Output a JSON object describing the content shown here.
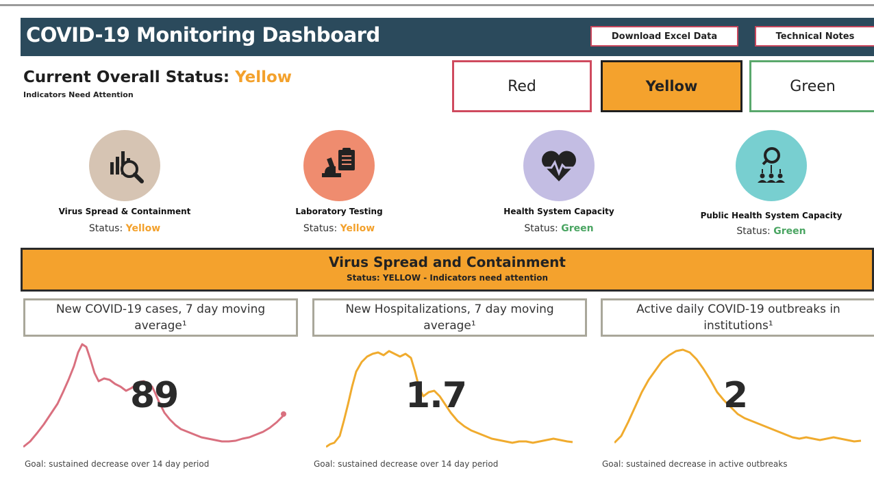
{
  "header": {
    "title": "COVID-19 Monitoring Dashboard",
    "download_label": "Download Excel Data",
    "notes_label": "Technical Notes"
  },
  "overall": {
    "label": "Current Overall Status:",
    "value": "Yellow",
    "subtitle": "Indicators Need Attention"
  },
  "status_boxes": [
    {
      "label": "Red",
      "color": "#cf4a5e"
    },
    {
      "label": "Yellow",
      "color": "#f4a22d"
    },
    {
      "label": "Green",
      "color": "#5aa86c"
    }
  ],
  "indicators": [
    {
      "name": "Virus Spread & Containment",
      "status_label": "Status:",
      "status": "Yellow",
      "icon": "chart-magnifier-icon",
      "circle_color": "#d6c4b3"
    },
    {
      "name": "Laboratory Testing",
      "status_label": "Status:",
      "status": "Yellow",
      "icon": "microscope-clipboard-icon",
      "circle_color": "#ef8c6f"
    },
    {
      "name": "Health System Capacity",
      "status_label": "Status:",
      "status": "Green",
      "icon": "heartbeat-icon",
      "circle_color": "#c3bde3"
    },
    {
      "name": "Public Health System Capacity",
      "status_label": "Status:",
      "status": "Green",
      "icon": "people-search-icon",
      "circle_color": "#78cfd0"
    }
  ],
  "section": {
    "title": "Virus Spread and Containment",
    "subtitle": "Status: YELLOW - Indicators need attention"
  },
  "metrics": [
    {
      "title": "New COVID-19 cases, 7 day moving average¹",
      "value": "89",
      "goal": "Goal: sustained decrease over 14  day period",
      "line_color": "#d9707f"
    },
    {
      "title": "New Hospitalizations, 7 day moving average¹",
      "value": "1.7",
      "goal": "Goal: sustained decrease over 14  day period",
      "line_color": "#f0ab2e"
    },
    {
      "title": "Active daily COVID-19 outbreaks in institutions¹",
      "value": "2",
      "goal": "Goal: sustained decrease in active outbreaks",
      "line_color": "#f0ab2e"
    }
  ]
}
